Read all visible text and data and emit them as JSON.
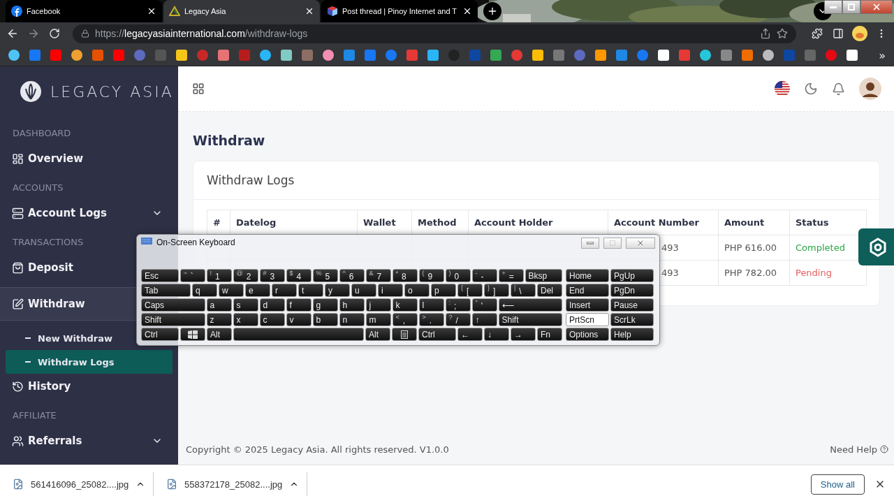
{
  "browser": {
    "tabs": [
      {
        "title": "Facebook",
        "selected": false
      },
      {
        "title": "Legacy Asia",
        "selected": true
      },
      {
        "title": "Post thread | Pinoy Internet and T",
        "selected": false
      }
    ],
    "address": {
      "scheme": "https://",
      "host": "legacyasiainternational.com",
      "path": "/withdraw-logs"
    },
    "bookmarks_overflow": "»"
  },
  "sidebar": {
    "logo": "LEGACY ASIA",
    "sections": [
      {
        "heading": "DASHBOARD",
        "items": [
          {
            "label": "Overview",
            "chevron": false,
            "selected": false
          }
        ]
      },
      {
        "heading": "ACCOUNTS",
        "items": [
          {
            "label": "Account Logs",
            "chevron": true,
            "selected": false
          }
        ]
      },
      {
        "heading": "TRANSACTIONS",
        "items": [
          {
            "label": "Deposit",
            "chevron": false,
            "selected": false
          },
          {
            "label": "Withdraw",
            "chevron": false,
            "selected": true,
            "children": [
              {
                "label": "New Withdraw",
                "selected": false
              },
              {
                "label": "Withdraw Logs",
                "selected": true
              }
            ]
          },
          {
            "label": "History",
            "chevron": false,
            "selected": false
          }
        ]
      },
      {
        "heading": "AFFILIATE",
        "items": [
          {
            "label": "Referrals",
            "chevron": true,
            "selected": false
          }
        ]
      }
    ]
  },
  "page": {
    "title": "Withdraw",
    "card_title": "Withdraw Logs",
    "table": {
      "columns": [
        "#",
        "Datelog",
        "Wallet",
        "Method",
        "Account Holder",
        "Account Number",
        "Amount",
        "Status"
      ],
      "rows": [
        {
          "account_number": "493",
          "amount": "PHP 616.00",
          "status": "Completed",
          "color": "#28a745"
        },
        {
          "account_number": "493",
          "amount": "PHP 782.00",
          "status": "Pending",
          "color": "#e35d5d"
        }
      ]
    }
  },
  "footer": {
    "copyright": "Copyright © 2025 Legacy Asia. All rights reserved. V1.0.0",
    "help": "Need Help"
  },
  "keyboard": {
    "title": "On-Screen Keyboard",
    "rows": [
      {
        "keys": [
          {
            "label": "Esc",
            "kind": "wide"
          },
          {
            "shift": "~",
            "label": "`",
            "kind": "key"
          },
          {
            "shift": "!",
            "label": "1",
            "kind": "key"
          },
          {
            "shift": "@",
            "label": "2",
            "kind": "key"
          },
          {
            "shift": "#",
            "label": "3",
            "kind": "key"
          },
          {
            "shift": "$",
            "label": "4",
            "kind": "key"
          },
          {
            "shift": "%",
            "label": "5",
            "kind": "key"
          },
          {
            "shift": "^",
            "label": "6",
            "kind": "key"
          },
          {
            "shift": "&",
            "label": "7",
            "kind": "key"
          },
          {
            "shift": "*",
            "label": "8",
            "kind": "key"
          },
          {
            "shift": "(",
            "label": "9",
            "kind": "key"
          },
          {
            "shift": ")",
            "label": "0",
            "kind": "key"
          },
          {
            "shift": "-",
            "label": "-",
            "kind": "key"
          },
          {
            "shift": "+",
            "label": "=",
            "kind": "key"
          },
          {
            "label": "Bksp",
            "kind": "wide"
          }
        ]
      },
      {
        "keys": [
          {
            "label": "Tab",
            "kind": "wide"
          },
          {
            "label": "q",
            "kind": "key"
          },
          {
            "label": "w",
            "kind": "key"
          },
          {
            "label": "e",
            "kind": "key"
          },
          {
            "label": "r",
            "kind": "key"
          },
          {
            "label": "t",
            "kind": "key"
          },
          {
            "label": "y",
            "kind": "key"
          },
          {
            "label": "u",
            "kind": "key"
          },
          {
            "label": "i",
            "kind": "key"
          },
          {
            "label": "o",
            "kind": "key"
          },
          {
            "label": "p",
            "kind": "key"
          },
          {
            "shift": "{",
            "label": "[",
            "kind": "key"
          },
          {
            "shift": "}",
            "label": "]",
            "kind": "key"
          },
          {
            "shift": "|",
            "label": "\\",
            "kind": "key"
          },
          {
            "label": "Del",
            "kind": "key"
          }
        ]
      },
      {
        "keys": [
          {
            "label": "Caps",
            "kind": "wide"
          },
          {
            "label": "a",
            "kind": "key"
          },
          {
            "label": "s",
            "kind": "key"
          },
          {
            "label": "d",
            "kind": "key"
          },
          {
            "label": "f",
            "kind": "key"
          },
          {
            "label": "g",
            "kind": "key"
          },
          {
            "label": "h",
            "kind": "key"
          },
          {
            "label": "j",
            "kind": "key"
          },
          {
            "label": "k",
            "kind": "key"
          },
          {
            "label": "l",
            "kind": "key"
          },
          {
            "shift": ":",
            "label": ";",
            "kind": "key"
          },
          {
            "shift": "\"",
            "label": "'",
            "kind": "key"
          },
          {
            "label": "⟵",
            "kind": "wide"
          }
        ]
      },
      {
        "keys": [
          {
            "label": "Shift",
            "kind": "wide"
          },
          {
            "label": "z",
            "kind": "key"
          },
          {
            "label": "x",
            "kind": "key"
          },
          {
            "label": "c",
            "kind": "key"
          },
          {
            "label": "v",
            "kind": "key"
          },
          {
            "label": "b",
            "kind": "key"
          },
          {
            "label": "n",
            "kind": "key"
          },
          {
            "label": "m",
            "kind": "key"
          },
          {
            "shift": "<",
            "label": ",",
            "kind": "key"
          },
          {
            "shift": ">",
            "label": ".",
            "kind": "key"
          },
          {
            "shift": "?",
            "label": "/",
            "kind": "key"
          },
          {
            "label": "↑",
            "kind": "key"
          },
          {
            "label": "Shift",
            "kind": "wide"
          }
        ]
      },
      {
        "keys": [
          {
            "label": "Ctrl",
            "kind": "mod"
          },
          {
            "kind": "windows"
          },
          {
            "label": "Alt",
            "kind": "key"
          },
          {
            "kind": "space"
          },
          {
            "label": "Alt",
            "kind": "key"
          },
          {
            "kind": "menu"
          },
          {
            "label": "Ctrl",
            "kind": "mod"
          },
          {
            "label": "←",
            "kind": "key"
          },
          {
            "label": "↓",
            "kind": "key"
          },
          {
            "label": "→",
            "kind": "key"
          },
          {
            "label": "Fn",
            "kind": "key"
          }
        ]
      }
    ],
    "nav": [
      {
        "label": "Home",
        "selected": false
      },
      {
        "label": "PgUp",
        "selected": false
      },
      {
        "label": "End",
        "selected": false
      },
      {
        "label": "PgDn",
        "selected": false
      },
      {
        "label": "Insert",
        "selected": false
      },
      {
        "label": "Pause",
        "selected": false
      },
      {
        "label": "PrtScn",
        "selected": true
      },
      {
        "label": "ScrLk",
        "selected": false
      },
      {
        "label": "Options",
        "selected": false
      },
      {
        "label": "Help",
        "selected": false
      }
    ]
  },
  "downloads": {
    "items": [
      {
        "name": "561416096_25082....jpg"
      },
      {
        "name": "558372178_25082....jpg"
      }
    ],
    "show_all": "Show all"
  }
}
